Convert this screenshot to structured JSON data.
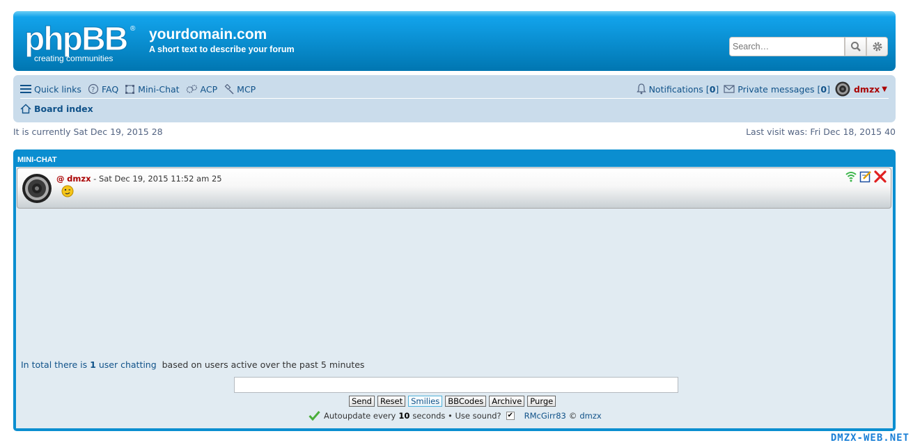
{
  "header": {
    "logo_text": "phpBB",
    "logo_tagline": "creating communities",
    "site_title": "yourdomain.com",
    "site_description": "A short text to describe your forum",
    "search_placeholder": "Search…"
  },
  "navbar": {
    "quick_links": "Quick links",
    "faq": "FAQ",
    "mini_chat": "Mini-Chat",
    "acp": "ACP",
    "mcp": "MCP",
    "notifications_label": "Notifications",
    "notifications_count": "0",
    "pm_label": "Private messages",
    "pm_count": "0",
    "username": "dmzx",
    "breadcrumb": "Board index"
  },
  "status": {
    "current_time": "It is currently Sat Dec 19, 2015 28",
    "last_visit": "Last visit was: Fri Dec 18, 2015 40"
  },
  "minichat": {
    "title": "MINI-CHAT",
    "messages": [
      {
        "at": "@",
        "author": "dmzx",
        "sep": " - ",
        "time": "Sat Dec 19, 2015 11:52 am 25"
      }
    ],
    "stats": {
      "prefix": "In total there is",
      "count": "1",
      "users_link": "user chatting",
      "suffix": "based on users active over the past 5 minutes"
    },
    "buttons": {
      "send": "Send",
      "reset": "Reset",
      "smilies": "Smilies",
      "bbcodes": "BBCodes",
      "archive": "Archive",
      "purge": "Purge"
    },
    "footer": {
      "autoupdate_prefix": "Autoupdate every",
      "seconds": "10",
      "autoupdate_suffix": "seconds • Use sound?",
      "credit_author": "RMcGirr83",
      "credit_sep": "©",
      "credit_owner": "dmzx"
    }
  },
  "watermark": "DMZX-WEB.NET",
  "colors": {
    "header_blue": "#0076b1",
    "navbar_bg": "#cadceb",
    "link": "#105289",
    "username": "#aa0000"
  }
}
